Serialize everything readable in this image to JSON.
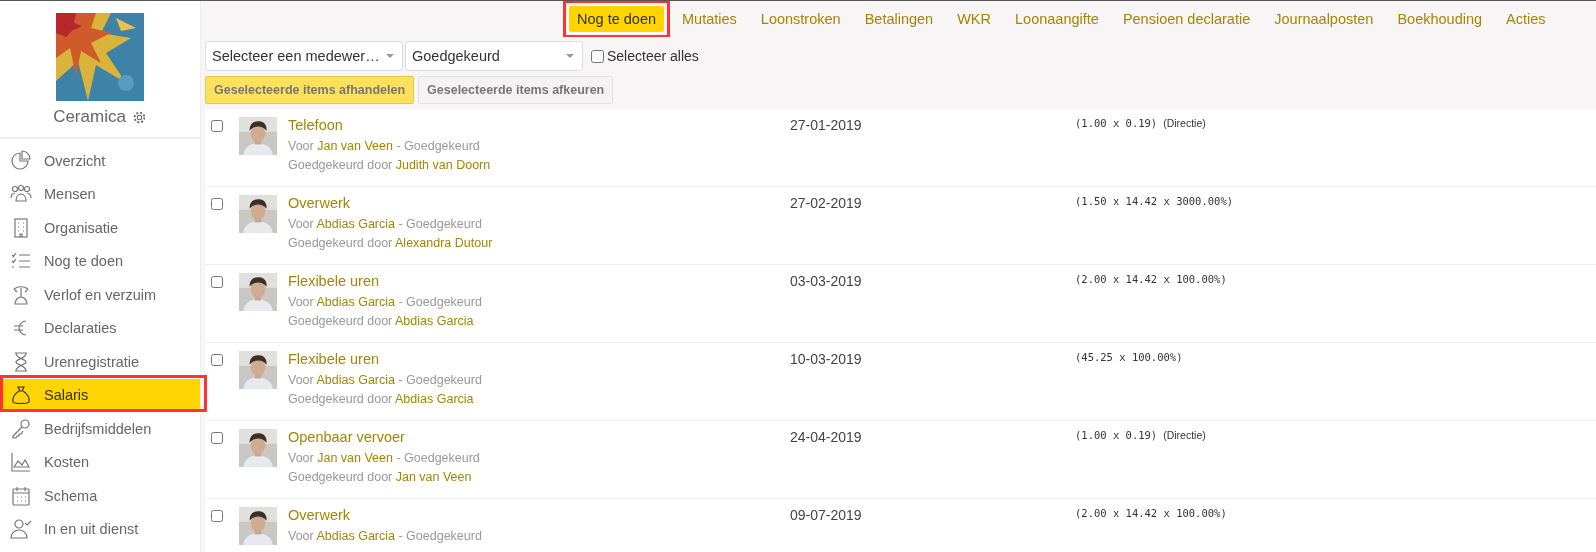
{
  "company": {
    "name": "Ceramica"
  },
  "sidebar": {
    "items": [
      {
        "label": "Overzicht",
        "selected": false,
        "highlighted": false
      },
      {
        "label": "Mensen",
        "selected": false,
        "highlighted": false
      },
      {
        "label": "Organisatie",
        "selected": false,
        "highlighted": false
      },
      {
        "label": "Nog te doen",
        "selected": false,
        "highlighted": false
      },
      {
        "label": "Verlof en verzuim",
        "selected": false,
        "highlighted": false
      },
      {
        "label": "Declaraties",
        "selected": false,
        "highlighted": false
      },
      {
        "label": "Urenregistratie",
        "selected": false,
        "highlighted": false
      },
      {
        "label": "Salaris",
        "selected": true,
        "highlighted": true
      },
      {
        "label": "Bedrijfsmiddelen",
        "selected": false,
        "highlighted": false
      },
      {
        "label": "Kosten",
        "selected": false,
        "highlighted": false
      },
      {
        "label": "Schema",
        "selected": false,
        "highlighted": false
      },
      {
        "label": "In en uit dienst",
        "selected": false,
        "highlighted": false
      }
    ]
  },
  "tabs": [
    {
      "label": "Nog te doen",
      "selected": true,
      "highlighted": true
    },
    {
      "label": "Mutaties",
      "selected": false,
      "highlighted": false
    },
    {
      "label": "Loonstroken",
      "selected": false,
      "highlighted": false
    },
    {
      "label": "Betalingen",
      "selected": false,
      "highlighted": false
    },
    {
      "label": "WKR",
      "selected": false,
      "highlighted": false
    },
    {
      "label": "Loonaangifte",
      "selected": false,
      "highlighted": false
    },
    {
      "label": "Pensioen declaratie",
      "selected": false,
      "highlighted": false
    },
    {
      "label": "Journaalposten",
      "selected": false,
      "highlighted": false
    },
    {
      "label": "Boekhouding",
      "selected": false,
      "highlighted": false
    },
    {
      "label": "Acties",
      "selected": false,
      "highlighted": false
    }
  ],
  "filters": {
    "employee": "Selecteer een medewer…",
    "status": "Goedgekeurd",
    "select_all": {
      "label": "Selecteer alles",
      "checked": false
    }
  },
  "actions": {
    "approve": "Geselecteerde items afhandelen",
    "reject": "Geselecteerde items afkeuren"
  },
  "items": [
    {
      "checked": false,
      "title": "Telefoon",
      "for_prefix": "Voor",
      "for": "Jan van Veen",
      "status": "- Goedgekeurd",
      "approved_prefix": "Goedgekeurd door",
      "approved_by": "Judith van Doorn",
      "date": "27-01-2019",
      "formula": "(1.00 x 0.19)",
      "note": "(Directie)"
    },
    {
      "checked": false,
      "title": "Overwerk",
      "for_prefix": "Voor",
      "for": "Abdias Garcia",
      "status": "- Goedgekeurd",
      "approved_prefix": "Goedgekeurd door",
      "approved_by": "Alexandra Dutour",
      "date": "27-02-2019",
      "formula": "(1.50 x 14.42 x 3000.00%)"
    },
    {
      "checked": false,
      "title": "Flexibele uren",
      "for_prefix": "Voor",
      "for": "Abdias Garcia",
      "status": "- Goedgekeurd",
      "approved_prefix": "Goedgekeurd door",
      "approved_by": "Abdias Garcia",
      "date": "03-03-2019",
      "formula": "(2.00 x 14.42 x 100.00%)"
    },
    {
      "checked": false,
      "title": "Flexibele uren",
      "for_prefix": "Voor",
      "for": "Abdias Garcia",
      "status": "- Goedgekeurd",
      "approved_prefix": "Goedgekeurd door",
      "approved_by": "Abdias Garcia",
      "date": "10-03-2019",
      "formula": "(45.25 x 100.00%)"
    },
    {
      "checked": false,
      "title": "Openbaar vervoer",
      "for_prefix": "Voor",
      "for": "Jan van Veen",
      "status": "- Goedgekeurd",
      "approved_prefix": "Goedgekeurd door",
      "approved_by": "Jan van Veen",
      "date": "24-04-2019",
      "formula": "(1.00 x 0.19)",
      "note": "(Directie)"
    },
    {
      "checked": false,
      "title": "Overwerk",
      "for_prefix": "Voor",
      "for": "Abdias Garcia",
      "status": "- Goedgekeurd",
      "date": "09-07-2019",
      "formula": "(2.00 x 14.42 x 100.00%)"
    }
  ]
}
